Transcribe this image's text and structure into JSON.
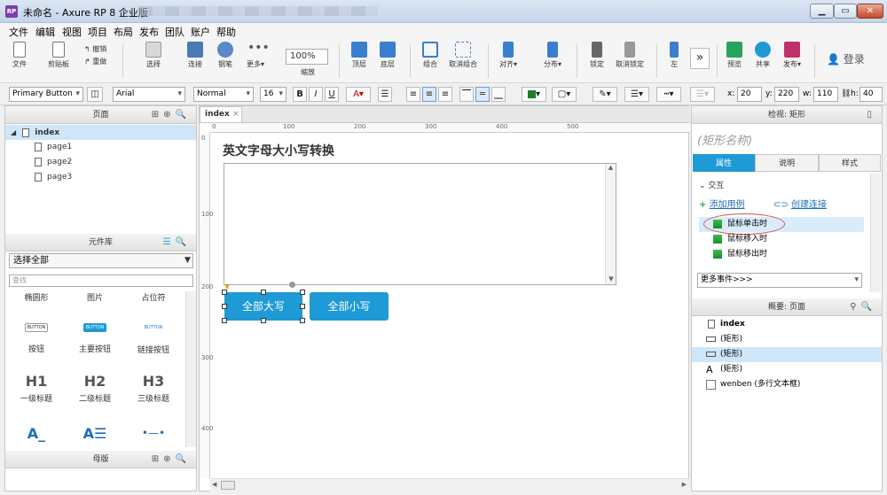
{
  "window": {
    "title": "未命名 - Axure RP 8 企业版",
    "app_icon": "RP"
  },
  "menu": [
    "文件",
    "编辑",
    "视图",
    "项目",
    "布局",
    "发布",
    "团队",
    "账户",
    "帮助"
  ],
  "toolbar": {
    "file": "文件",
    "clipboard": "剪贴板",
    "undo": "撤销",
    "redo": "重做",
    "select": "选择",
    "connect": "连接",
    "pen": "钢笔",
    "more": "更多▾",
    "zoom_value": "100%",
    "zoom_label": "缩放",
    "top": "顶层",
    "bottom": "底层",
    "group": "组合",
    "ungroup": "取消组合",
    "align": "对齐▾",
    "distribute": "分布▾",
    "lock": "锁定",
    "unlock": "取消锁定",
    "left": "左",
    "preview": "预览",
    "share": "共享",
    "publish": "发布▾",
    "login": "登录"
  },
  "formatbar": {
    "style": "Primary Button",
    "font": "Arial",
    "weight": "Normal",
    "size": "16",
    "x_label": "x:",
    "x": "20",
    "y_label": "y:",
    "y": "220",
    "w_label": "w:",
    "w": "110",
    "h_label": "h:",
    "h": "40"
  },
  "pages_panel": {
    "title": "页面",
    "root": "index",
    "pages": [
      "page1",
      "page2",
      "page3"
    ]
  },
  "library_panel": {
    "title": "元件库",
    "selected": "选择全部",
    "search_placeholder": "查找",
    "row0": [
      "椭圆形",
      "图片",
      "占位符"
    ],
    "buttons": {
      "mini_button": "BUTTON",
      "mini_primary": "BUTTON",
      "mini_link": "BUTTON",
      "labels": [
        "按钮",
        "主要按钮",
        "链接按钮"
      ]
    },
    "headings": {
      "symbols": [
        "H1",
        "H2",
        "H3"
      ],
      "labels": [
        "一级标题",
        "二级标题",
        "三级标题"
      ]
    }
  },
  "masters_panel": {
    "title": "母版"
  },
  "canvas": {
    "tab": "index",
    "heading": "英文字母大小写转换",
    "btn_upper": "全部大写",
    "btn_lower": "全部小写",
    "ruler_h": [
      "0",
      "100",
      "200",
      "300",
      "400",
      "500"
    ],
    "ruler_v": [
      "0",
      "100",
      "200",
      "300",
      "400"
    ]
  },
  "inspector": {
    "title": "检视: 矩形",
    "shape_name": "(矩形名称)",
    "tabs": [
      "属性",
      "说明",
      "样式"
    ],
    "interaction": "交互",
    "add_case": "添加用例",
    "create_link": "创建连接",
    "events": [
      "鼠标单击时",
      "鼠标移入时",
      "鼠标移出时"
    ],
    "more_events": "更多事件>>>"
  },
  "outline": {
    "title": "概要: 页面",
    "root": "index",
    "items": [
      "(矩形)",
      "(矩形)",
      "(矩形)",
      "wenben (多行文本框)"
    ]
  },
  "colors": {
    "accent": "#1e9ad6",
    "selection": "#cfe6f8",
    "event_highlight": "#d9ecfa",
    "annotation_red": "#d9534f"
  }
}
